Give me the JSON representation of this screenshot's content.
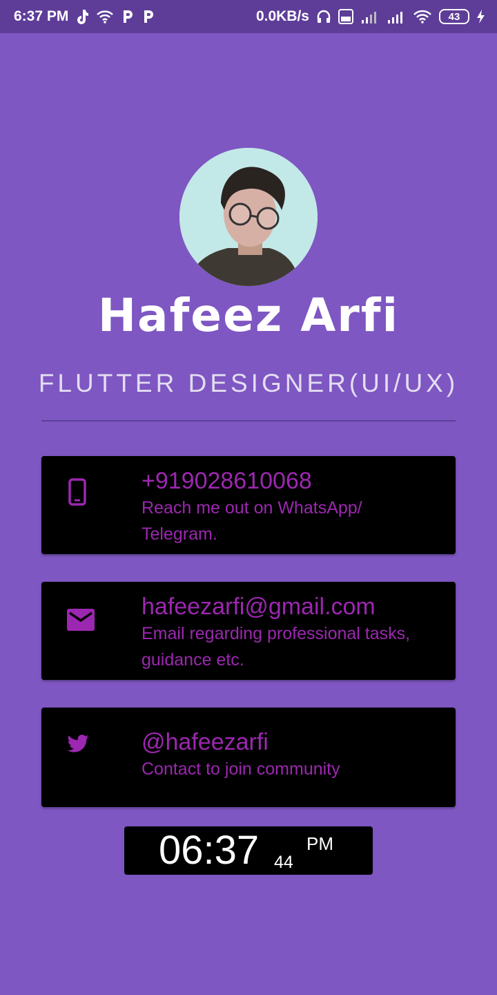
{
  "status_bar": {
    "time": "6:37 PM",
    "net_speed": "0.0KB/s",
    "battery": "43",
    "icons": [
      "tiktok-icon",
      "wifi-icon",
      "p-icon",
      "p-icon",
      "headphones-icon",
      "volte-icon",
      "signal-icon",
      "signal-icon",
      "wifi-icon",
      "battery-icon",
      "charging-icon"
    ]
  },
  "profile": {
    "name": "Hafeez Arfi",
    "title": "FLUTTER DESIGNER(UI/UX)"
  },
  "cards": [
    {
      "icon": "phone-icon",
      "main": "+919028610068",
      "sub": "Reach me out on WhatsApp/ Telegram."
    },
    {
      "icon": "email-icon",
      "main": "hafeezarfi@gmail.com",
      "sub": "Email regarding professional tasks, guidance etc."
    },
    {
      "icon": "twitter-icon",
      "main": "@hafeezarfi",
      "sub": "Contact to join community"
    }
  ],
  "clock": {
    "time": "06:37",
    "seconds": "44",
    "ampm": "PM"
  },
  "colors": {
    "background": "#7e57c2",
    "status_bar": "#5e3d99",
    "accent": "#9c27b0",
    "card": "#000000"
  }
}
